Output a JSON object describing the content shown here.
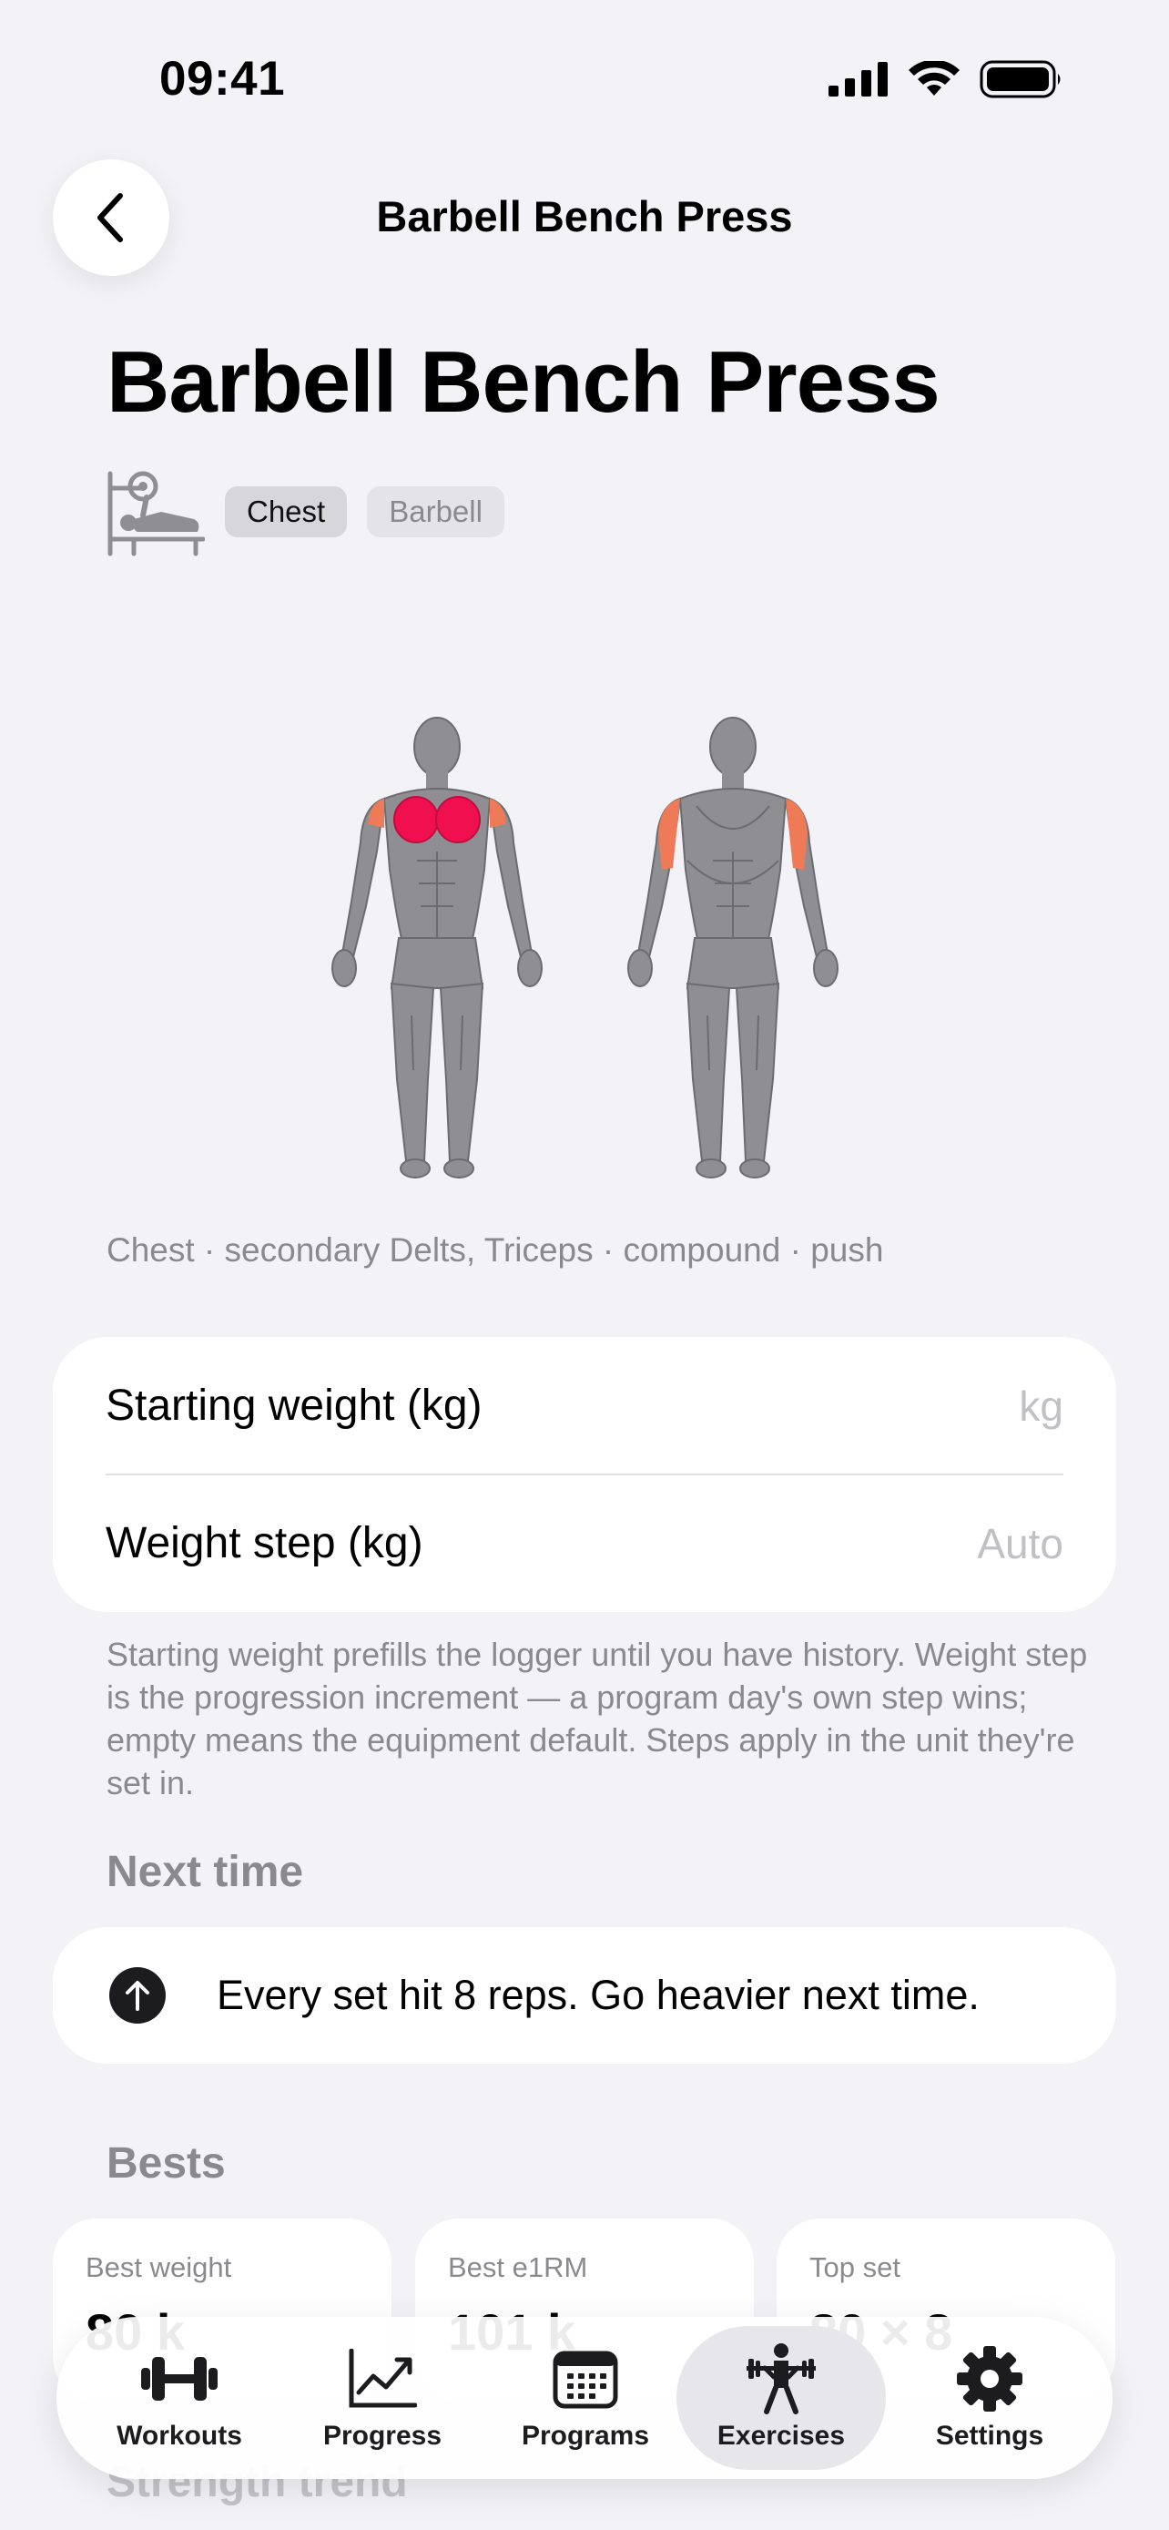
{
  "status_bar": {
    "time": "09:41"
  },
  "nav": {
    "title": "Barbell Bench Press"
  },
  "exercise": {
    "name": "Barbell Bench Press",
    "primary_muscle": "Chest",
    "equipment": "Barbell",
    "summary": "Chest · secondary Delts, Triceps · compound · push"
  },
  "settings": {
    "starting_weight_label": "Starting weight (kg)",
    "starting_weight_placeholder": "kg",
    "weight_step_label": "Weight step (kg)",
    "weight_step_placeholder": "Auto",
    "footnote": "Starting weight prefills the logger until you have history. Weight step is the progression increment — a program day's own step wins; empty means the equipment default. Steps apply in the unit they're set in."
  },
  "next_time": {
    "header": "Next time",
    "message": "Every set hit 8 reps. Go heavier next time."
  },
  "bests": {
    "header": "Bests",
    "items": [
      {
        "label": "Best weight",
        "value": "80 k"
      },
      {
        "label": "Best e1RM",
        "value": "101 k"
      },
      {
        "label": "Top set",
        "value": "80 × 8"
      }
    ]
  },
  "next_section_header": "Strength trend",
  "tabs": [
    {
      "label": "Workouts",
      "icon": "dumbbell-icon"
    },
    {
      "label": "Progress",
      "icon": "chart-icon"
    },
    {
      "label": "Programs",
      "icon": "calendar-icon"
    },
    {
      "label": "Exercises",
      "icon": "weightlifter-icon",
      "active": true
    },
    {
      "label": "Settings",
      "icon": "gear-icon"
    }
  ],
  "colors": {
    "primary_muscle": "#f0104f",
    "secondary_muscle": "#ef7a57",
    "body": "#8e8e93"
  }
}
